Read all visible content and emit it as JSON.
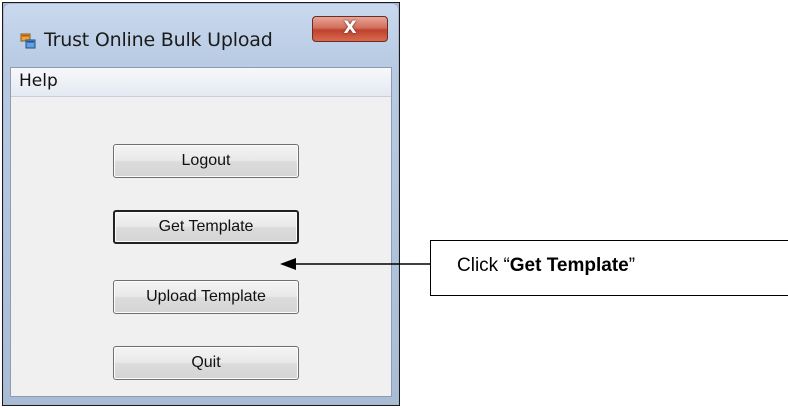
{
  "window": {
    "title": "Trust Online Bulk Upload",
    "close_glyph": "X"
  },
  "menubar": {
    "items": [
      {
        "label": "Help"
      }
    ]
  },
  "buttons": {
    "logout": "Logout",
    "get_template": "Get Template",
    "upload_template": "Upload Template",
    "quit": "Quit"
  },
  "callout": {
    "prefix": "Click “",
    "emphasis": "Get Template",
    "suffix": "”"
  },
  "colors": {
    "close_button": "#c0412d",
    "client_bg": "#f0f0f0",
    "frame_border": "#1a1a1a"
  }
}
